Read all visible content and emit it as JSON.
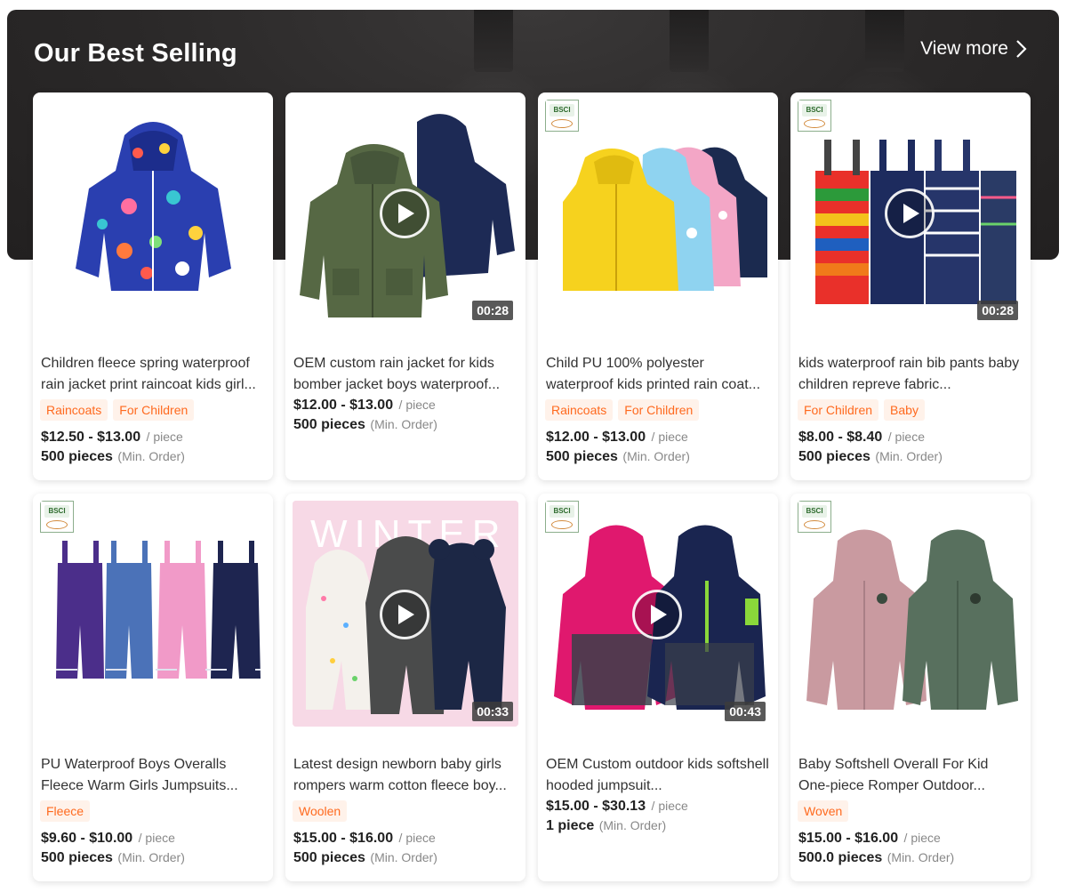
{
  "section": {
    "title": "Our Best Selling",
    "view_more": "View more"
  },
  "products": [
    {
      "name": "Children fleece spring waterproof rain jacket print raincoat kids girl...",
      "tags": [
        "Raincoats",
        "For Children"
      ],
      "price": "$12.50 - $13.00",
      "price_unit": "/ piece",
      "moq": "500 pieces",
      "moq_label": "(Min. Order)",
      "bsci": false,
      "video": false,
      "duration": ""
    },
    {
      "name": "OEM custom rain jacket for kids bomber jacket boys waterproof...",
      "tags": [],
      "price": "$12.00 - $13.00",
      "price_unit": "/ piece",
      "moq": "500 pieces",
      "moq_label": "(Min. Order)",
      "bsci": false,
      "video": true,
      "duration": "00:28"
    },
    {
      "name": "Child PU 100% polyester waterproof kids printed rain coat...",
      "tags": [
        "Raincoats",
        "For Children"
      ],
      "price": "$12.00 - $13.00",
      "price_unit": "/ piece",
      "moq": "500 pieces",
      "moq_label": "(Min. Order)",
      "bsci": true,
      "video": false,
      "duration": ""
    },
    {
      "name": "kids waterproof rain bib pants baby children repreve fabric...",
      "tags": [
        "For Children",
        "Baby"
      ],
      "price": "$8.00 - $8.40",
      "price_unit": "/ piece",
      "moq": "500 pieces",
      "moq_label": "(Min. Order)",
      "bsci": true,
      "video": true,
      "duration": "00:28"
    },
    {
      "name": "PU Waterproof Boys Overalls Fleece Warm Girls Jumpsuits...",
      "tags": [
        "Fleece"
      ],
      "price": "$9.60 - $10.00",
      "price_unit": "/ piece",
      "moq": "500 pieces",
      "moq_label": "(Min. Order)",
      "bsci": true,
      "video": false,
      "duration": ""
    },
    {
      "name": "Latest design newborn baby girls rompers warm cotton fleece boy...",
      "tags": [
        "Woolen"
      ],
      "price": "$15.00 - $16.00",
      "price_unit": "/ piece",
      "moq": "500 pieces",
      "moq_label": "(Min. Order)",
      "bsci": false,
      "video": true,
      "duration": "00:33",
      "image_text": "WINTER"
    },
    {
      "name": "OEM Custom outdoor kids softshell hooded jumpsuit...",
      "tags": [],
      "price": "$15.00 - $30.13",
      "price_unit": "/ piece",
      "moq": "1 piece",
      "moq_label": "(Min. Order)",
      "bsci": true,
      "video": true,
      "duration": "00:43"
    },
    {
      "name": "Baby Softshell Overall For Kid One-piece Romper Outdoor...",
      "tags": [
        "Woven"
      ],
      "price": "$15.00 - $16.00",
      "price_unit": "/ piece",
      "moq": "500.0 pieces",
      "moq_label": "(Min. Order)",
      "bsci": true,
      "video": false,
      "duration": ""
    }
  ],
  "badge_text": "BSCI",
  "colors": {
    "banner_bg": "#2a2828",
    "tag_bg": "#fff2ea",
    "tag_text": "#ff6a1f"
  }
}
